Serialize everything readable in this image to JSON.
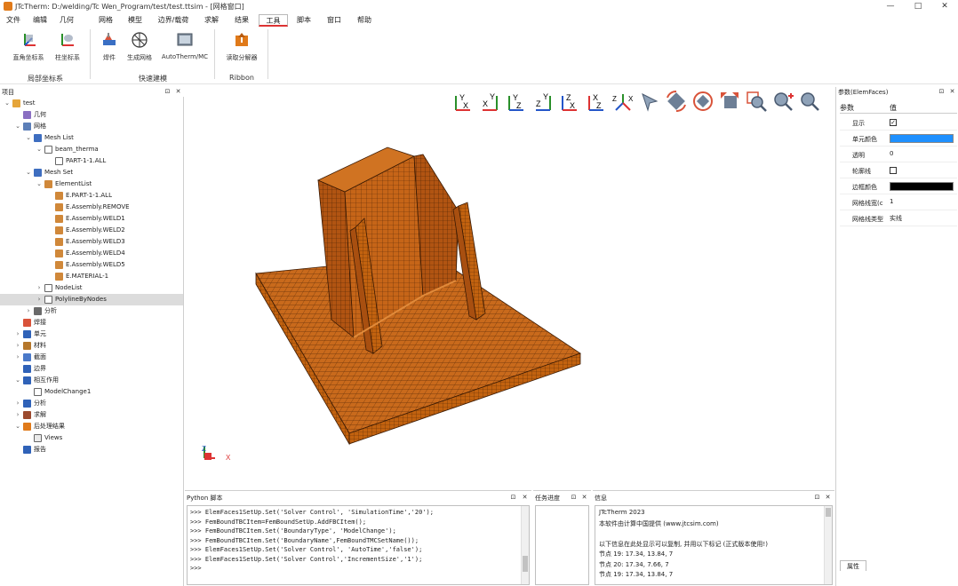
{
  "window": {
    "title": "JTcTherm: D:/welding/Tc Wen_Program/test/test.ttsim - [网格窗口]",
    "controls": [
      "—",
      "□",
      "✕"
    ]
  },
  "menubar": {
    "items": [
      "文件",
      "编辑",
      "几何",
      "网格",
      "模型",
      "边界/载荷",
      "求解",
      "结果",
      "工具",
      "脚本",
      "窗口",
      "帮助"
    ],
    "active": "工具"
  },
  "ribbon": {
    "groups": [
      {
        "label": "局部坐标系",
        "buttons": [
          "直角坐标系",
          "柱坐标系"
        ]
      },
      {
        "label": "快速建模",
        "buttons": [
          "焊件",
          "生成网格",
          "AutoTherm/MC"
        ]
      },
      {
        "label": "Ribbon",
        "buttons": [
          "读取分解器"
        ]
      }
    ]
  },
  "project_panel": {
    "title": "项目",
    "tree": [
      {
        "label": "test",
        "level": 0,
        "expanded": true,
        "icon": "folder-open-icon"
      },
      {
        "label": "几何",
        "level": 1,
        "icon": "geometry-icon"
      },
      {
        "label": "网格",
        "level": 1,
        "expanded": true,
        "icon": "mesh-icon"
      },
      {
        "label": "Mesh List",
        "level": 2,
        "expanded": true,
        "icon": "mesh-list-icon"
      },
      {
        "label": "beam_therma",
        "level": 3,
        "expanded": true,
        "icon": "checkbox-icon"
      },
      {
        "label": "PART-1-1.ALL",
        "level": 4,
        "icon": "part-icon"
      },
      {
        "label": "Mesh Set",
        "level": 2,
        "expanded": true,
        "icon": "mesh-set-icon"
      },
      {
        "label": "ElementList",
        "level": 3,
        "expanded": true,
        "icon": "element-list-icon"
      },
      {
        "label": "E.PART-1-1.ALL",
        "level": 4,
        "icon": "element-icon"
      },
      {
        "label": "E.Assembly.REMOVE",
        "level": 4,
        "icon": "element-icon"
      },
      {
        "label": "E.Assembly.WELD1",
        "level": 4,
        "icon": "element-icon"
      },
      {
        "label": "E.Assembly.WELD2",
        "level": 4,
        "icon": "element-icon"
      },
      {
        "label": "E.Assembly.WELD3",
        "level": 4,
        "icon": "element-icon"
      },
      {
        "label": "E.Assembly.WELD4",
        "level": 4,
        "icon": "element-icon"
      },
      {
        "label": "E.Assembly.WELD5",
        "level": 4,
        "icon": "element-icon"
      },
      {
        "label": "E.MATERIAL-1",
        "level": 4,
        "icon": "element-icon"
      },
      {
        "label": "NodeList",
        "level": 3,
        "collapsed": true,
        "icon": "node-list-icon"
      },
      {
        "label": "PolylineByNodes",
        "level": 3,
        "collapsed": true,
        "icon": "polyline-icon",
        "selected": true
      },
      {
        "label": "分析",
        "level": 2,
        "collapsed": true,
        "icon": "analysis-icon"
      },
      {
        "label": "焊接",
        "level": 1,
        "icon": "weld-icon"
      },
      {
        "label": "单元",
        "level": 1,
        "collapsed": true,
        "icon": "unit-icon"
      },
      {
        "label": "材料",
        "level": 1,
        "collapsed": true,
        "icon": "material-icon"
      },
      {
        "label": "截面",
        "level": 1,
        "collapsed": true,
        "icon": "section-icon"
      },
      {
        "label": "边界",
        "level": 1,
        "icon": "boundary-icon"
      },
      {
        "label": "相互作用",
        "level": 1,
        "expanded": true,
        "icon": "interaction-icon"
      },
      {
        "label": "ModelChange1",
        "level": 2,
        "icon": "model-change-icon"
      },
      {
        "label": "分析",
        "level": 1,
        "collapsed": true,
        "icon": "step-icon"
      },
      {
        "label": "求解",
        "level": 1,
        "collapsed": true,
        "icon": "solve-icon"
      },
      {
        "label": "后处理结果",
        "level": 1,
        "expanded": true,
        "icon": "results-icon"
      },
      {
        "label": "Views",
        "level": 2,
        "icon": "views-icon"
      },
      {
        "label": "报告",
        "level": 1,
        "icon": "report-icon"
      }
    ]
  },
  "view_toolbar": {
    "buttons": [
      "view-yx-icon",
      "view-xy-icon",
      "view-yz-icon",
      "view-zy-icon",
      "view-zx-icon",
      "view-xz-icon",
      "view-iso-icon",
      "select-icon",
      "rotate-icon",
      "pan-rotate-icon",
      "fit-icon",
      "zoom-window-icon",
      "zoom-in-icon",
      "zoom-icon"
    ]
  },
  "viewport": {
    "triad": {
      "z": "Z",
      "x": "X"
    },
    "mesh_color": "#c96a1c"
  },
  "properties": {
    "title": "参数(ElemFaces)",
    "col_key": "参数",
    "col_val": "值",
    "rows": [
      {
        "key": "显示",
        "type": "check",
        "value": "✓"
      },
      {
        "key": "单元颜色",
        "type": "color",
        "value": "#1e90ff"
      },
      {
        "key": "透明",
        "type": "text",
        "value": "0"
      },
      {
        "key": "轮廓线",
        "type": "check",
        "value": ""
      },
      {
        "key": "边框颜色",
        "type": "color",
        "value": "#000000"
      },
      {
        "key": "网格线宽(c",
        "type": "text",
        "value": "1"
      },
      {
        "key": "网格线类型",
        "type": "text",
        "value": "实线"
      }
    ],
    "footer_tab": "属性"
  },
  "python_panel": {
    "title": "Python 脚本",
    "lines": [
      ">>> ElemFaces1SetUp.Set('Solver Control', 'SimulationTime','20');",
      ">>> FemBoundTBCItem=FemBoundSetUp.AddFBCItem();",
      ">>> FemBoundTBCItem.Set('BoundaryType', 'ModelChange');",
      ">>> FemBoundTBCItem.Set('BoundaryName',FemBoundTMCSetName());",
      ">>> ElemFaces1SetUp.Set('Solver Control', 'AutoTime','false');",
      ">>> ElemFaces1SetUp.Set('Solver Control','IncrementSize','1');",
      ">>>"
    ]
  },
  "task_panel": {
    "title": "任务进度"
  },
  "message_panel": {
    "title": "信息",
    "lines": [
      "    JTcTherm 2023",
      "本软件由计算中国提供 (www.jtcsim.com)",
      "",
      "以下信息在此处显示可以复制, 并用以下标记 (正式版本使用!)",
      "节点 19: 17.34, 13.84, 7",
      "节点 20: 17.34, 7.66, 7",
      "节点 19: 17.34, 13.84, 7"
    ]
  }
}
